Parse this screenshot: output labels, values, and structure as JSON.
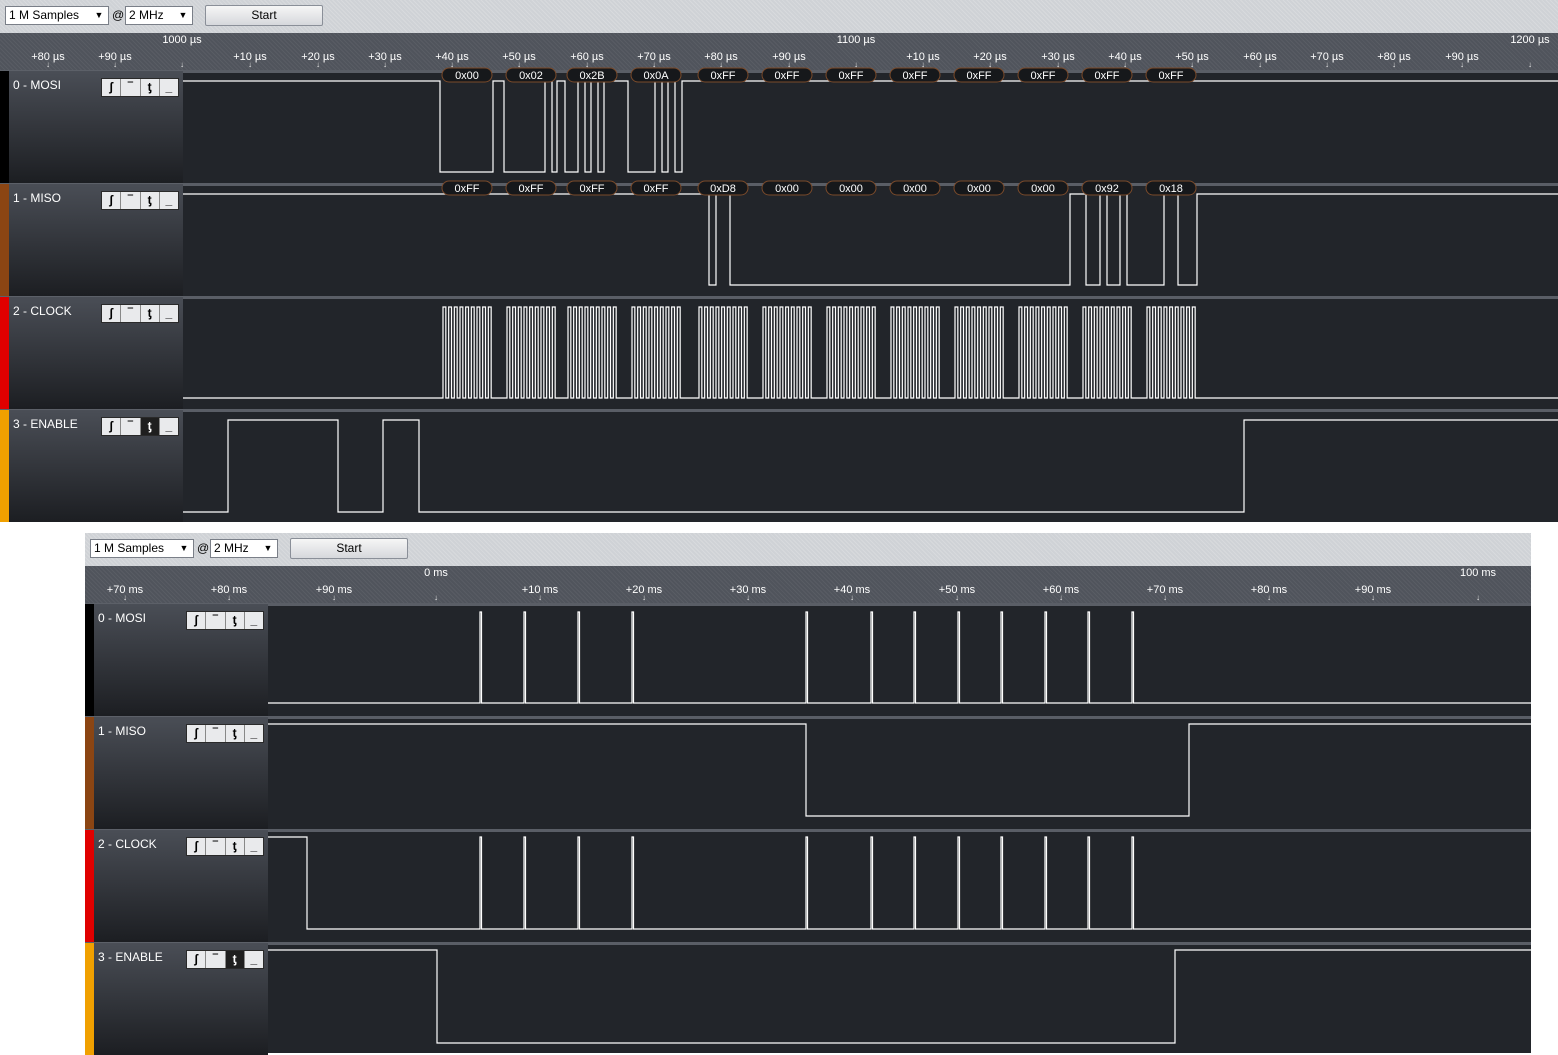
{
  "panes": [
    {
      "samples_value": "1 M Samples",
      "at": "@",
      "rate_value": "2 MHz",
      "start_label": "Start",
      "ruler": {
        "small": [
          "+80 µs",
          "+90 µs",
          "+10 µs",
          "+20 µs",
          "+30 µs",
          "+40 µs",
          "+50 µs",
          "+60 µs",
          "+70 µs",
          "+80 µs",
          "+90 µs",
          "+10 µs",
          "+20 µs",
          "+30 µs",
          "+40 µs",
          "+50 µs",
          "+60 µs",
          "+70 µs",
          "+80 µs",
          "+90 µs"
        ],
        "big": [
          "1000 µs",
          "1100 µs",
          "1200 µs"
        ]
      },
      "channels": [
        {
          "name": "0 - MOSI",
          "color": "#000000"
        },
        {
          "name": "1 - MISO",
          "color": "#8b4513"
        },
        {
          "name": "2 - CLOCK",
          "color": "#e00000"
        },
        {
          "name": "3 - ENABLE",
          "color": "#f0a000"
        }
      ],
      "mosi_bytes": [
        "0x00",
        "0x02",
        "0x2B",
        "0x0A",
        "0xFF",
        "0xFF",
        "0xFF",
        "0xFF",
        "0xFF",
        "0xFF",
        "0xFF",
        "0xFF"
      ],
      "miso_bytes": [
        "0xFF",
        "0xFF",
        "0xFF",
        "0xFF",
        "0xD8",
        "0x00",
        "0x00",
        "0x00",
        "0x00",
        "0x00",
        "0x92",
        "0x18"
      ]
    },
    {
      "samples_value": "1 M Samples",
      "at": "@",
      "rate_value": "2 MHz",
      "start_label": "Start",
      "ruler": {
        "small": [
          "+70 ms",
          "+80 ms",
          "+90 ms",
          "+10 ms",
          "+20 ms",
          "+30 ms",
          "+40 ms",
          "+50 ms",
          "+60 ms",
          "+70 ms",
          "+80 ms",
          "+90 ms"
        ],
        "big": [
          "0 ms",
          "100 ms"
        ]
      },
      "channels": [
        {
          "name": "0 - MOSI",
          "color": "#000000"
        },
        {
          "name": "1 - MISO",
          "color": "#8b4513"
        },
        {
          "name": "2 - CLOCK",
          "color": "#e00000"
        },
        {
          "name": "3 - ENABLE",
          "color": "#f0a000"
        }
      ]
    }
  ],
  "trigger_icons": [
    "rising-edge-icon",
    "high-level-icon",
    "falling-edge-icon",
    "low-level-icon"
  ],
  "trigger_glyphs": [
    "ʃ",
    "‾",
    "ƫ",
    "_"
  ]
}
